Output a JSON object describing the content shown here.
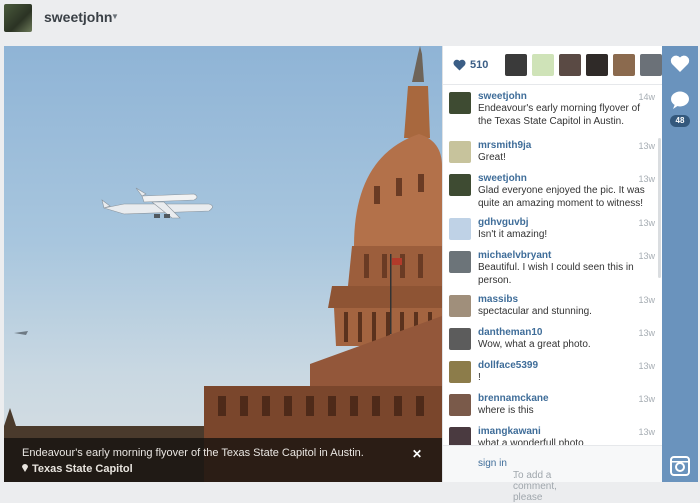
{
  "header": {
    "username": "sweetjohn"
  },
  "photo": {
    "caption": "Endeavour's early morning flyover of the Texas State Capitol in Austin.",
    "location": "Texas State Capitol"
  },
  "likes": {
    "count": "510",
    "likers": [
      "#3a3a3a",
      "#cfe3b8",
      "#5a4a44",
      "#2f2a28",
      "#8b6a4e",
      "#6b7178"
    ]
  },
  "comments": [
    {
      "user": "sweetjohn",
      "text": "Endeavour's early morning flyover of the Texas State Capitol in Austin.",
      "time": "14w",
      "avatar": "#3e4b32"
    },
    {
      "user": "mrsmith9ja",
      "text": "Great!",
      "time": "13w",
      "avatar": "#c7c39c"
    },
    {
      "user": "sweetjohn",
      "text": "Glad everyone enjoyed the pic. It was quite an amazing moment to witness!",
      "time": "13w",
      "avatar": "#3e4b32"
    },
    {
      "user": "gdhvguvbj",
      "text": "Isn't it amazing!",
      "time": "13w",
      "avatar": "#bfd2e6"
    },
    {
      "user": "michaelvbryant",
      "text": "Beautiful. I wish I could seen this in person.",
      "time": "13w",
      "avatar": "#6c7479"
    },
    {
      "user": "massibs",
      "text": "spectacular and stunning.",
      "time": "13w",
      "avatar": "#a08f7b"
    },
    {
      "user": "dantheman10",
      "text": "Wow, what a great photo.",
      "time": "13w",
      "avatar": "#5c5c5c"
    },
    {
      "user": "dollface5399",
      "text": "!",
      "time": "13w",
      "avatar": "#8c7c4a"
    },
    {
      "user": "brennamckane",
      "text": "where is this",
      "time": "13w",
      "avatar": "#7a5a4a"
    },
    {
      "user": "imangkawani",
      "text": "what a wonderfull photo",
      "time": "13w",
      "avatar": "#4a3a40"
    }
  ],
  "add_comment": {
    "prefix": "To add a comment, please",
    "link": "sign in",
    "suffix": "."
  },
  "actions": {
    "comment_count": "48"
  }
}
